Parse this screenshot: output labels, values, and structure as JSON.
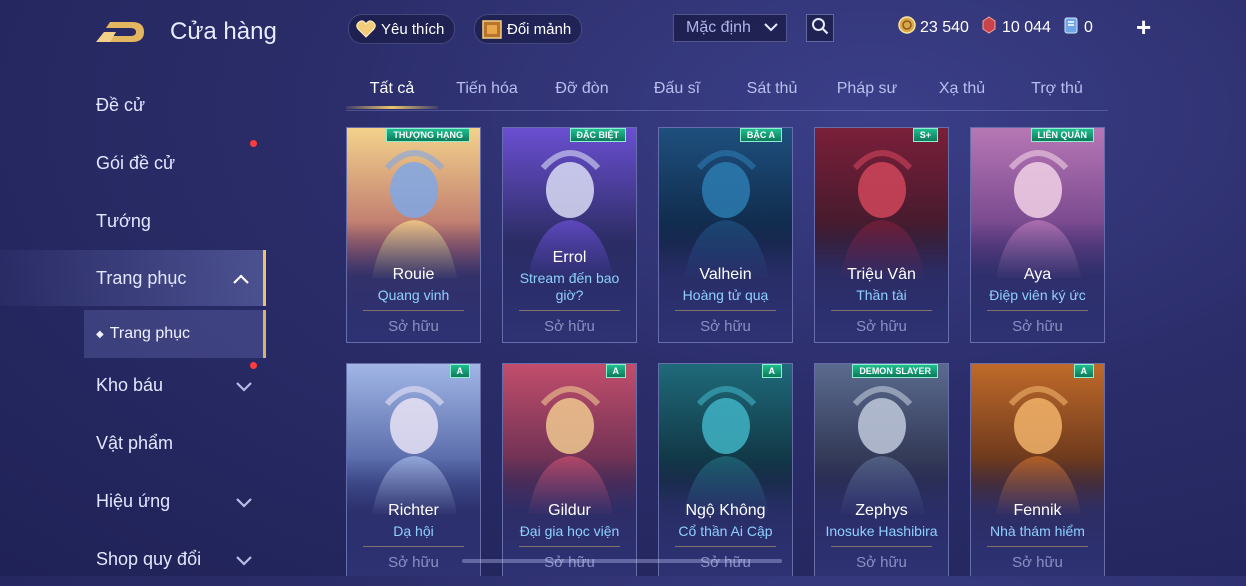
{
  "header": {
    "title": "Cửa hàng",
    "favorites_label": "Yêu thích",
    "exchange_label": "Đổi mảnh",
    "sort_label": "Mặc định",
    "currencies": [
      {
        "icon": "gold-coin-icon",
        "value": "23 540"
      },
      {
        "icon": "red-gem-icon",
        "value": "10 044"
      },
      {
        "icon": "voucher-icon",
        "value": "0"
      }
    ],
    "add_label": "+"
  },
  "sidebar": {
    "items": [
      {
        "label": "Đề cử"
      },
      {
        "label": "Gói đề cử"
      },
      {
        "label": "Tướng"
      },
      {
        "label": "Trang phục"
      },
      {
        "label": "Kho báu"
      },
      {
        "label": "Vật phẩm"
      },
      {
        "label": "Hiệu ứng"
      },
      {
        "label": "Shop quy đổi"
      }
    ],
    "sub_item": "Trang phục"
  },
  "tabs": [
    "Tất cả",
    "Tiến hóa",
    "Đỡ đòn",
    "Đấu sĩ",
    "Sát thủ",
    "Pháp sư",
    "Xạ thủ",
    "Trợ thủ"
  ],
  "active_tab": "Tất cả",
  "skins": [
    {
      "hero": "Rouie",
      "skin": "Quang vinh",
      "status": "Sở hữu",
      "badge": "THƯỢNG HẠNG",
      "colors": [
        "#f3d28b",
        "#7fa7e6",
        "#b56a6a"
      ]
    },
    {
      "hero": "Errol",
      "skin": "Stream đến bao giờ?",
      "status": "Sở hữu",
      "badge": "ĐẶC BIỆT",
      "colors": [
        "#6a4fd1",
        "#d9dcf5",
        "#2a2b60"
      ]
    },
    {
      "hero": "Valhein",
      "skin": "Hoàng tử quạ",
      "status": "Sở hữu",
      "badge": "BẬC A",
      "colors": [
        "#1e4f7e",
        "#2c7bb0",
        "#0e2442"
      ]
    },
    {
      "hero": "Triệu Vân",
      "skin": "Thần tài",
      "status": "Sở hữu",
      "badge": "S+",
      "colors": [
        "#7a1f3a",
        "#d0455b",
        "#3a1a2a"
      ]
    },
    {
      "hero": "Aya",
      "skin": "Điệp viên ký ức",
      "status": "Sở hữu",
      "badge": "LIÊN QUÂN",
      "colors": [
        "#b777b5",
        "#f2d1e6",
        "#6b3f86"
      ]
    },
    {
      "hero": "Richter",
      "skin": "Dạ hội",
      "status": "Sở hữu",
      "badge": "A",
      "colors": [
        "#a1b6e6",
        "#e9e3f5",
        "#4a5c9d"
      ]
    },
    {
      "hero": "Gildur",
      "skin": "Đại gia học viện",
      "status": "Sở hữu",
      "badge": "A",
      "colors": [
        "#c24d6c",
        "#f0c88f",
        "#5d2c4f"
      ]
    },
    {
      "hero": "Ngộ Không",
      "skin": "Cổ thần Ai Cập",
      "status": "Sở hữu",
      "badge": "A",
      "colors": [
        "#1f6a7a",
        "#3fb3c4",
        "#0e2c3a"
      ]
    },
    {
      "hero": "Zephys",
      "skin": "Inosuke Hashibira",
      "status": "Sở hữu",
      "badge": "DEMON SLAYER",
      "colors": [
        "#5a6a8e",
        "#bfc9dc",
        "#2a2e4a"
      ]
    },
    {
      "hero": "Fennik",
      "skin": "Nhà thám hiểm",
      "status": "Sở hữu",
      "badge": "A",
      "colors": [
        "#c06a2a",
        "#f1b36a",
        "#5a2e1a"
      ]
    }
  ]
}
